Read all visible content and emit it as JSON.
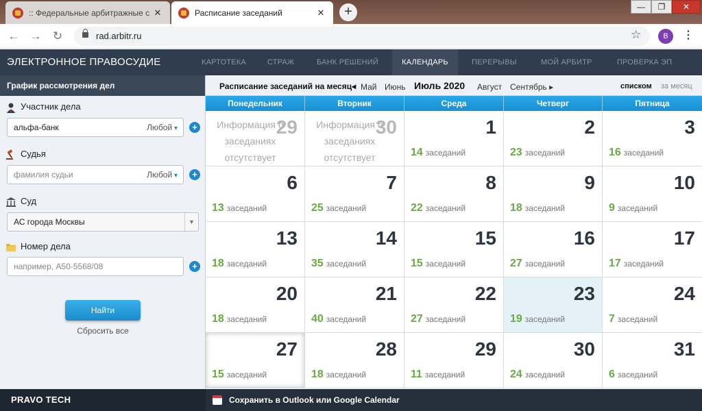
{
  "browser": {
    "tabs": [
      {
        "title": ":: Федеральные арбитражные с"
      },
      {
        "title": "Расписание заседаний"
      }
    ],
    "new_tab": "+",
    "url": "rad.arbitr.ru",
    "profile_initial": "B",
    "window_controls": {
      "min": "—",
      "max": "❐",
      "close": "✕"
    }
  },
  "site": {
    "brand": "ЭЛЕКТРОННОЕ ПРАВОСУДИЕ",
    "nav": [
      "КАРТОТЕКА",
      "СТРАЖ",
      "БАНК РЕШЕНИЙ",
      "КАЛЕНДАРЬ",
      "ПЕРЕРЫВЫ",
      "МОЙ АРБИТР",
      "ПРОВЕРКА ЭП"
    ],
    "active_nav": "КАЛЕНДАРЬ"
  },
  "sidebar": {
    "header": "График рассмотрения дел",
    "participant": {
      "label": "Участник дела",
      "value": "альфа-банк",
      "mode": "Любой"
    },
    "judge": {
      "label": "Судья",
      "placeholder": "фамилия судьи",
      "mode": "Любой"
    },
    "court": {
      "label": "Суд",
      "value": "АС города Москвы"
    },
    "case_number": {
      "label": "Номер дела",
      "placeholder": "например, А50-5568/08"
    },
    "find_label": "Найти",
    "reset_label": "Сбросить все"
  },
  "calendar": {
    "header_label": "Расписание заседаний на месяц",
    "prev_arrow": "◂",
    "next_arrow": "▸",
    "months": {
      "prev2": "Май",
      "prev1": "Июнь",
      "current": "Июль 2020",
      "next1": "Август",
      "next2": "Сентябрь"
    },
    "view_list": "списком",
    "view_month": "за месяц",
    "weekdays": [
      "Понедельник",
      "Вторник",
      "Среда",
      "Четверг",
      "Пятница"
    ],
    "sessions_word": "заседаний",
    "no_info": "Информация о заседаниях отсутствует",
    "days": [
      {
        "day": "29",
        "count": null,
        "prev": true
      },
      {
        "day": "30",
        "count": null,
        "prev": true
      },
      {
        "day": "1",
        "count": "14"
      },
      {
        "day": "2",
        "count": "23"
      },
      {
        "day": "3",
        "count": "16"
      },
      {
        "day": "6",
        "count": "13"
      },
      {
        "day": "7",
        "count": "25"
      },
      {
        "day": "8",
        "count": "22"
      },
      {
        "day": "9",
        "count": "18"
      },
      {
        "day": "10",
        "count": "9"
      },
      {
        "day": "13",
        "count": "18"
      },
      {
        "day": "14",
        "count": "35"
      },
      {
        "day": "15",
        "count": "15"
      },
      {
        "day": "16",
        "count": "27"
      },
      {
        "day": "17",
        "count": "17"
      },
      {
        "day": "20",
        "count": "18"
      },
      {
        "day": "21",
        "count": "40"
      },
      {
        "day": "22",
        "count": "27"
      },
      {
        "day": "23",
        "count": "19",
        "today": true
      },
      {
        "day": "24",
        "count": "7"
      },
      {
        "day": "27",
        "count": "15",
        "selected": true
      },
      {
        "day": "28",
        "count": "18"
      },
      {
        "day": "29",
        "count": "11"
      },
      {
        "day": "30",
        "count": "24"
      },
      {
        "day": "31",
        "count": "6"
      }
    ]
  },
  "footer": {
    "brand": "PRAVO TECH",
    "save_calendar": "Сохранить в Outlook или Google Calendar"
  },
  "colors": {
    "accent": "#1b8fd2",
    "count_green": "#6aa944",
    "header_dark": "#2f3d4e"
  }
}
